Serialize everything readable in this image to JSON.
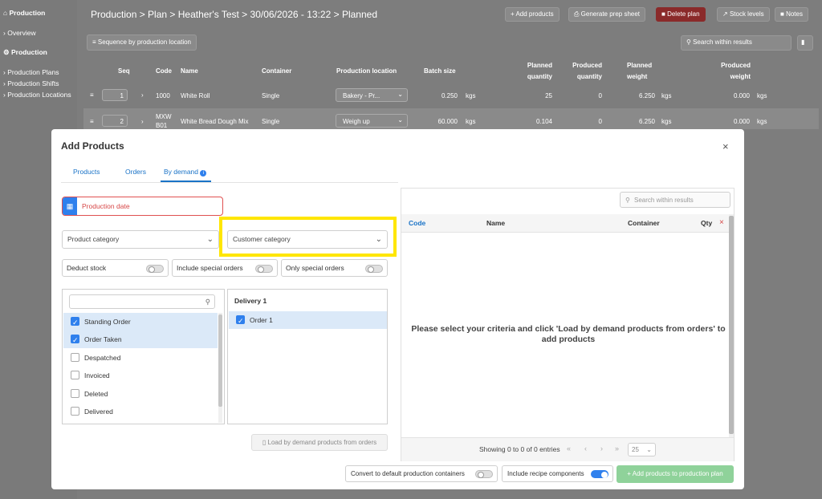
{
  "sidebar": {
    "section1": "Production",
    "overview": "Overview",
    "section2": "Production",
    "items": [
      "Production Plans",
      "Production Shifts",
      "Production Locations"
    ]
  },
  "header": {
    "breadcrumb": "Production > Plan > Heather's Test > 30/06/2026 - 13:22 > Planned",
    "add_products": "+ Add products",
    "generate_prep": "Generate prep sheet",
    "delete_plan": "Delete plan",
    "stock_levels": "Stock levels",
    "notes": "Notes",
    "sequence_btn": "Sequence by production location",
    "search_placeholder": "Search within results"
  },
  "table": {
    "columns": [
      "Seq",
      "Code",
      "Name",
      "Container",
      "Production location",
      "Batch size",
      "Planned quantity",
      "Produced quantity",
      "Planned weight",
      "Produced weight"
    ],
    "col_planned_qty_1": "Planned",
    "col_planned_qty_2": "quantity",
    "col_produced_qty_1": "Produced",
    "col_produced_qty_2": "quantity",
    "col_planned_w_1": "Planned",
    "col_planned_w_2": "weight",
    "col_produced_w_1": "Produced",
    "col_produced_w_2": "weight",
    "rows": [
      {
        "seq": "1",
        "code": "1000",
        "name": "White Roll",
        "container": "Single",
        "location": "Bakery - Pr...",
        "batch": "0.250",
        "batch_unit": "kgs",
        "planned_qty": "25",
        "produced_qty": "0",
        "planned_w": "6.250",
        "planned_w_unit": "kgs",
        "produced_w": "0.000",
        "produced_w_unit": "kgs"
      },
      {
        "seq": "2",
        "code": "MXW B01",
        "code1": "MXW",
        "code2": "B01",
        "name": "White Bread Dough Mix",
        "container": "Single",
        "location": "Weigh up",
        "batch": "60.000",
        "batch_unit": "kgs",
        "planned_qty": "0.104",
        "produced_qty": "0",
        "planned_w": "6.250",
        "planned_w_unit": "kgs",
        "produced_w": "0.000",
        "produced_w_unit": "kgs"
      }
    ]
  },
  "modal": {
    "title": "Add Products",
    "close": "×",
    "tabs": [
      "Products",
      "Orders",
      "By demand"
    ],
    "production_date": "Production date",
    "product_category": "Product category",
    "customer_category": "Customer category",
    "deduct_stock": "Deduct stock",
    "include_special": "Include special orders",
    "only_special": "Only special orders",
    "statuses": [
      {
        "label": "Standing Order",
        "checked": true
      },
      {
        "label": "Order Taken",
        "checked": true
      },
      {
        "label": "Despatched",
        "checked": false
      },
      {
        "label": "Invoiced",
        "checked": false
      },
      {
        "label": "Deleted",
        "checked": false
      },
      {
        "label": "Delivered",
        "checked": false
      }
    ],
    "delivery_header": "Delivery 1",
    "delivery_item": "Order 1",
    "load_btn": "Load by demand products from orders",
    "results": {
      "search_placeholder": "Search within results",
      "col_code": "Code",
      "col_name": "Name",
      "col_container": "Container",
      "col_qty": "Qty",
      "empty_msg": "Please select your criteria and click 'Load by demand products from orders' to add products",
      "showing": "Showing 0 to 0 of 0 entries",
      "page_size": "25"
    },
    "convert_default": "Convert to default production containers",
    "include_recipe": "Include recipe components",
    "add_to_plan": "+ Add products to production plan"
  }
}
